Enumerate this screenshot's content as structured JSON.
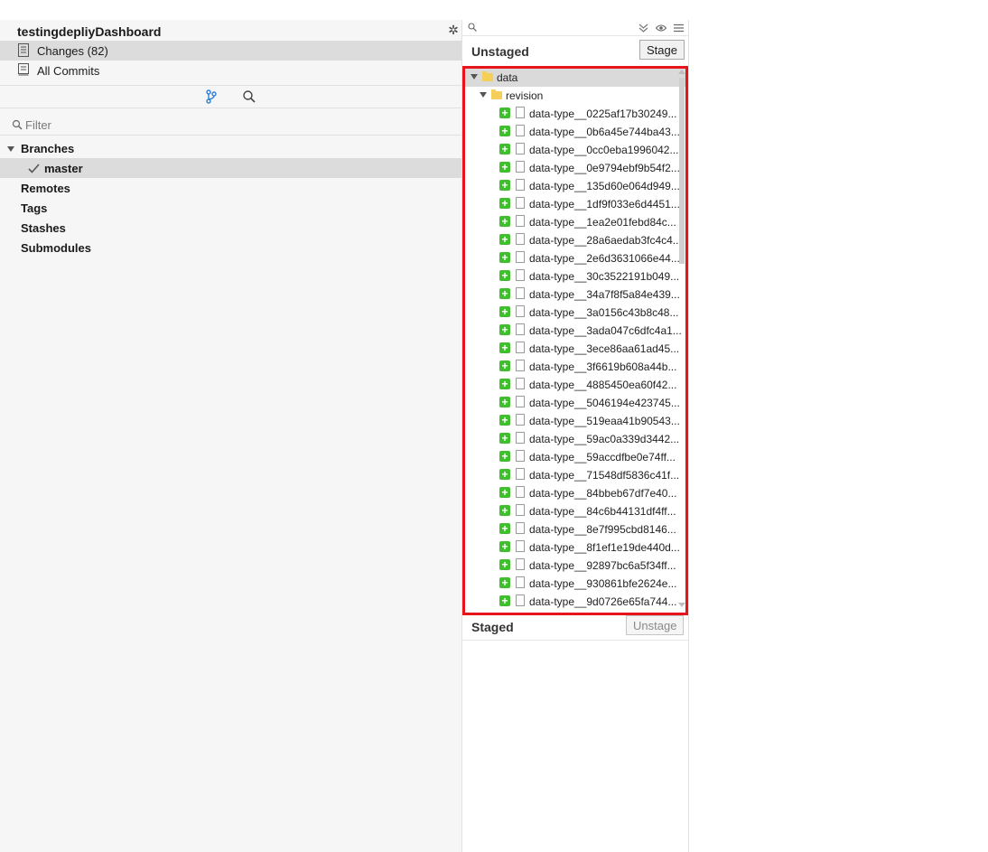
{
  "sidebar": {
    "repo_title": "testingdepliyDashboard",
    "nav": [
      {
        "label": "Changes (82)",
        "selected": true
      },
      {
        "label": "All Commits",
        "selected": false
      }
    ],
    "filter_placeholder": "Filter",
    "tree": {
      "branches_label": "Branches",
      "current_branch": "master",
      "remotes_label": "Remotes",
      "tags_label": "Tags",
      "stashes_label": "Stashes",
      "submodules_label": "Submodules"
    }
  },
  "panel": {
    "unstaged_title": "Unstaged",
    "stage_label": "Stage",
    "staged_title": "Staged",
    "unstage_label": "Unstage",
    "folder_root": "data",
    "folder_child": "revision",
    "files": [
      "data-type__0225af17b30249...",
      "data-type__0b6a45e744ba43...",
      "data-type__0cc0eba1996042...",
      "data-type__0e9794ebf9b54f2...",
      "data-type__135d60e064d949...",
      "data-type__1df9f033e6d4451...",
      "data-type__1ea2e01febd84c...",
      "data-type__28a6aedab3fc4c4...",
      "data-type__2e6d3631066e44...",
      "data-type__30c3522191b049...",
      "data-type__34a7f8f5a84e439...",
      "data-type__3a0156c43b8c48...",
      "data-type__3ada047c6dfc4a1...",
      "data-type__3ece86aa61ad45...",
      "data-type__3f6619b608a44b...",
      "data-type__4885450ea60f42...",
      "data-type__5046194e423745...",
      "data-type__519eaa41b90543...",
      "data-type__59ac0a339d3442...",
      "data-type__59accdfbe0e74ff...",
      "data-type__71548df5836c41f...",
      "data-type__84bbeb67df7e40...",
      "data-type__84c6b44131df4ff...",
      "data-type__8e7f995cbd8146...",
      "data-type__8f1ef1e19de440d...",
      "data-type__92897bc6a5f34ff...",
      "data-type__930861bfe2624e...",
      "data-type__9d0726e65fa744..."
    ]
  },
  "colors": {
    "highlight_border": "#e8141c",
    "added_badge": "#3fbf2e",
    "folder": "#f6cf5b",
    "selection": "#dcdcdc",
    "accent_icon": "#2d7fd3"
  }
}
